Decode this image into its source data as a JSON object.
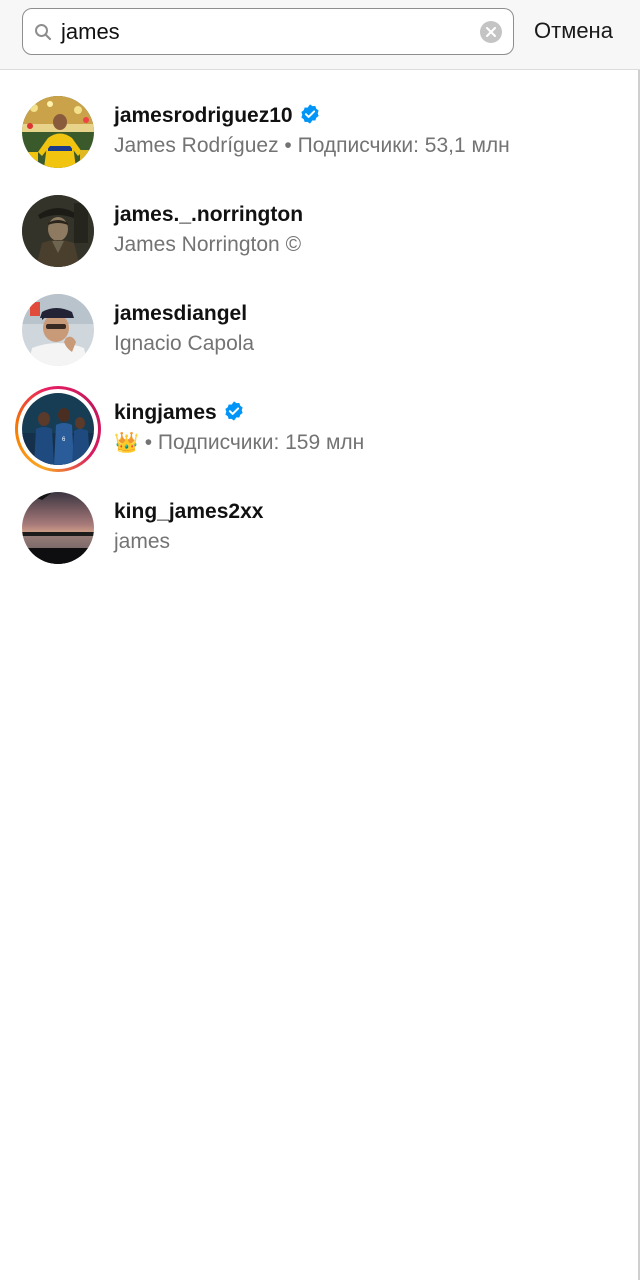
{
  "search": {
    "query": "james",
    "cancel_label": "Отмена"
  },
  "results": [
    {
      "username": "jamesrodriguez10",
      "verified": true,
      "subtitle": "James Rodríguez • Подписчики: 53,1 млн",
      "avatar": "soccer-player-avatar"
    },
    {
      "username": "james._.norrington",
      "verified": false,
      "subtitle": "James Norrington ©",
      "avatar": "pirate-avatar"
    },
    {
      "username": "jamesdiangel",
      "verified": false,
      "subtitle": "Ignacio Capola",
      "avatar": "man-with-cap-avatar"
    },
    {
      "username": "kingjames",
      "verified": true,
      "subtitle_emoji": "👑",
      "subtitle": " • Подписчики: 159 млн",
      "avatar": "basketball-team-avatar",
      "has_story": true
    },
    {
      "username": "king_james2xx",
      "verified": false,
      "subtitle": "james",
      "avatar": "sunset-lake-avatar"
    }
  ],
  "colors": {
    "verified_badge": "#0095f6",
    "subtitle": "#737373",
    "story_ring_start": "#f9a825",
    "story_ring_end": "#d81b60"
  }
}
